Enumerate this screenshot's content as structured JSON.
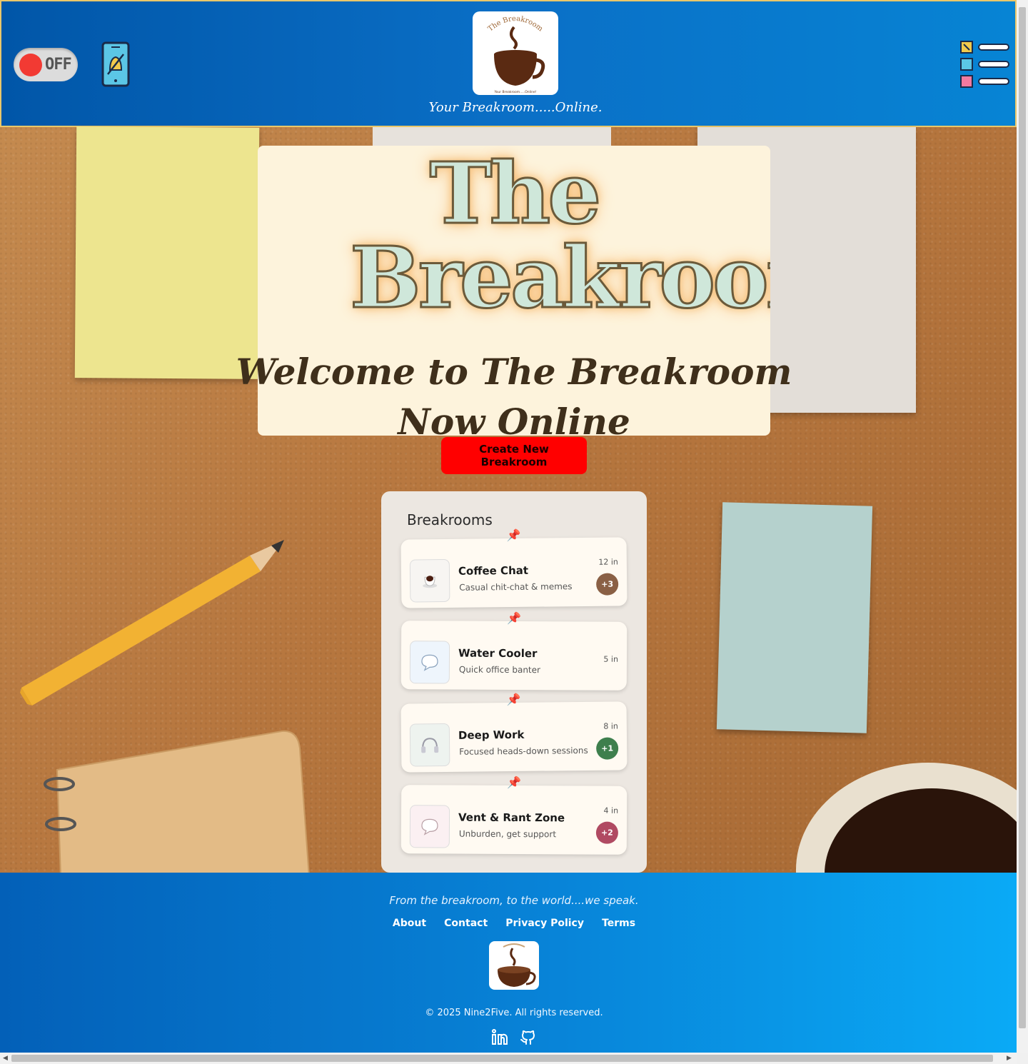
{
  "header": {
    "toggle_label": "OFF",
    "logo_arc_text": "The Breakroom",
    "logo_small_text": "Your Breakroom.....Online!",
    "tagline": "Your Breakroom.....Online."
  },
  "hero": {
    "title": "The Breakroom",
    "subtitle_line1": "Welcome to The Breakroom",
    "subtitle_line2": "Now Online",
    "create_button": "Create New Breakroom"
  },
  "breakrooms": {
    "title": "Breakrooms",
    "items": [
      {
        "name": "Coffee Chat",
        "description": "Casual chit-chat & memes",
        "count": "12 in",
        "badge": "+3",
        "badge_color": "#8a6045",
        "icon": "coffee-cup-icon"
      },
      {
        "name": "Water Cooler",
        "description": "Quick office banter",
        "count": "5 in",
        "badge": "",
        "badge_color": "",
        "icon": "speech-bubble-icon"
      },
      {
        "name": "Deep Work",
        "description": "Focused heads-down sessions",
        "count": "8 in",
        "badge": "+1",
        "badge_color": "#3e7f4d",
        "icon": "headphones-icon"
      },
      {
        "name": "Vent & Rant Zone",
        "description": "Unburden, get support",
        "count": "4 in",
        "badge": "+2",
        "badge_color": "#b04a62",
        "icon": "speech-bubble-icon"
      }
    ]
  },
  "footer": {
    "quote": "From the breakroom, to the world....we speak.",
    "links": [
      "About",
      "Contact",
      "Privacy Policy",
      "Terms"
    ],
    "copyright": "© 2025 Nine2Five. All rights reserved.",
    "social": [
      "linkedin-icon",
      "github-icon"
    ]
  },
  "colors": {
    "header_blue": "#0a6fc6",
    "create_button": "#ff0000",
    "toggle_knob": "#f23a33"
  }
}
